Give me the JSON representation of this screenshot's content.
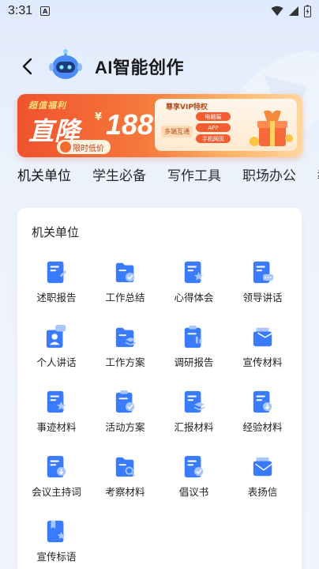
{
  "status_bar": {
    "time": "3:31",
    "notif": "A"
  },
  "header": {
    "title": "AI智能创作"
  },
  "banner": {
    "tag": "超值福利",
    "headline": "直降",
    "currency": "¥",
    "amount": "188",
    "limit_label": "限时低价",
    "vip_title": "尊享VIP特权",
    "vip_terminal": "多端互通",
    "vip_platforms": [
      "电脑端",
      "APP",
      "手机网页"
    ]
  },
  "tabs": [
    "机关单位",
    "学生必备",
    "写作工具",
    "职场办公",
    "教"
  ],
  "active_tab": 0,
  "section": {
    "title": "机关单位",
    "items": [
      {
        "label": "述职报告",
        "icon": "report-doc-icon"
      },
      {
        "label": "工作总结",
        "icon": "folder-check-icon"
      },
      {
        "label": "心得体会",
        "icon": "doc-star-icon"
      },
      {
        "label": "领导讲话",
        "icon": "speech-doc-icon"
      },
      {
        "label": "个人讲话",
        "icon": "person-chat-icon"
      },
      {
        "label": "工作方案",
        "icon": "folder-layers-icon"
      },
      {
        "label": "调研报告",
        "icon": "clipboard-chart-icon"
      },
      {
        "label": "宣传材料",
        "icon": "envelope-check-icon"
      },
      {
        "label": "事迹材料",
        "icon": "doc-star-icon"
      },
      {
        "label": "活动方案",
        "icon": "clipboard-check-icon"
      },
      {
        "label": "汇报材料",
        "icon": "doc-layers-icon"
      },
      {
        "label": "经验材料",
        "icon": "doc-down-icon"
      },
      {
        "label": "会议主持词",
        "icon": "doc-down-icon"
      },
      {
        "label": "考察材料",
        "icon": "folder-search-icon"
      },
      {
        "label": "倡议书",
        "icon": "doc-check-icon"
      },
      {
        "label": "表扬信",
        "icon": "envelope-open-icon"
      },
      {
        "label": "宣传标语",
        "icon": "bookmark-star-icon"
      }
    ]
  },
  "colors": {
    "accent": "#2d6cf5",
    "icon_primary": "#3a7bfd",
    "icon_light": "#a9c6ff",
    "banner_start": "#f0522d"
  }
}
